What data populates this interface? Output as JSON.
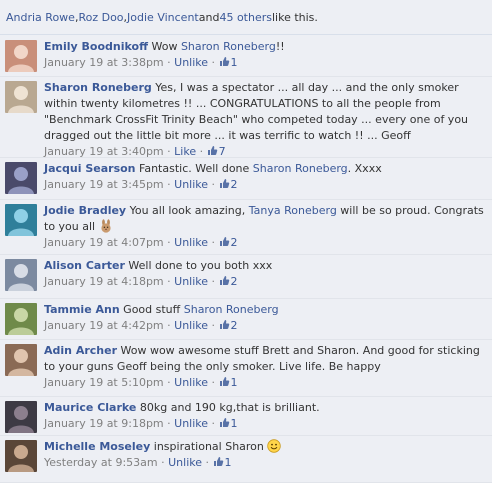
{
  "likes": {
    "names": [
      "Andria Rowe",
      "Roz Doo",
      "Jodie Vincent"
    ],
    "sep1": ", ",
    "sep2": ", ",
    "and": " and ",
    "others": "45 others",
    "tail": " like this."
  },
  "comments": [
    {
      "author": "Emily Boodnikoff",
      "parts": [
        {
          "t": "Wow "
        },
        {
          "m": "Sharon Roneberg"
        },
        {
          "t": "!!"
        }
      ],
      "time": "January 19 at 3:38pm",
      "action": "Unlike",
      "likes": "1",
      "avatar": {
        "bg": "#c98f7a",
        "fg": "#f2d6c8"
      }
    },
    {
      "author": "Sharon Roneberg",
      "parts": [
        {
          "t": "Yes, I was a spectator ... all day ... and the only smoker within twenty kilometres !! ... CONGRATULATIONS to all the people from \"Benchmark CrossFit Trinity Beach\" who competed today ... every one of you dragged out the little bit more ... it was terrific to watch !! ... Geoff"
        }
      ],
      "time": "January 19 at 3:40pm",
      "action": "Like",
      "likes": "7",
      "avatar": {
        "bg": "#b9a891",
        "fg": "#efe3d3"
      }
    },
    {
      "author": "Jacqui Searson",
      "parts": [
        {
          "t": "Fantastic. Well done "
        },
        {
          "m": "Sharon Roneberg"
        },
        {
          "t": ". Xxxx"
        }
      ],
      "time": "January 19 at 3:45pm",
      "action": "Unlike",
      "likes": "2",
      "avatar": {
        "bg": "#4a4a6a",
        "fg": "#9aa0c8"
      }
    },
    {
      "author": "Jodie Bradley",
      "parts": [
        {
          "t": "You all look amazing, "
        },
        {
          "m": "Tanya Roneberg"
        },
        {
          "t": " will be so proud. Congrats to you all "
        },
        {
          "e": "bunny"
        }
      ],
      "time": "January 19 at 4:07pm",
      "action": "Unlike",
      "likes": "2",
      "avatar": {
        "bg": "#2f7f9a",
        "fg": "#8fd0e6"
      }
    },
    {
      "author": "Alison Carter",
      "parts": [
        {
          "t": "Well done to you both xxx"
        }
      ],
      "time": "January 19 at 4:18pm",
      "action": "Unlike",
      "likes": "2",
      "avatar": {
        "bg": "#7c8aa0",
        "fg": "#d8dde6"
      }
    },
    {
      "author": "Tammie Ann",
      "parts": [
        {
          "t": "Good stuff "
        },
        {
          "m": "Sharon Roneberg"
        }
      ],
      "time": "January 19 at 4:42pm",
      "action": "Unlike",
      "likes": "2",
      "avatar": {
        "bg": "#6f8a4a",
        "fg": "#c9d7a6"
      }
    },
    {
      "author": "Adin Archer",
      "parts": [
        {
          "t": "Wow wow awesome stuff Brett and Sharon. And good for sticking to your guns Geoff being the only smoker. Live life. Be happy"
        }
      ],
      "time": "January 19 at 5:10pm",
      "action": "Unlike",
      "likes": "1",
      "avatar": {
        "bg": "#8a6a55",
        "fg": "#e0c4ae"
      }
    },
    {
      "author": "Maurice Clarke",
      "parts": [
        {
          "t": "80kg and 190 kg,that is brilliant."
        }
      ],
      "time": "January 19 at 9:18pm",
      "action": "Unlike",
      "likes": "1",
      "avatar": {
        "bg": "#3d3a44",
        "fg": "#8c7f8e"
      }
    },
    {
      "author": "Michelle Moseley",
      "parts": [
        {
          "t": "inspirational Sharon "
        },
        {
          "e": "smile"
        }
      ],
      "time": "Yesterday at 9:53am",
      "action": "Unlike",
      "likes": "1",
      "avatar": {
        "bg": "#5a4638",
        "fg": "#c9a98f"
      }
    }
  ]
}
